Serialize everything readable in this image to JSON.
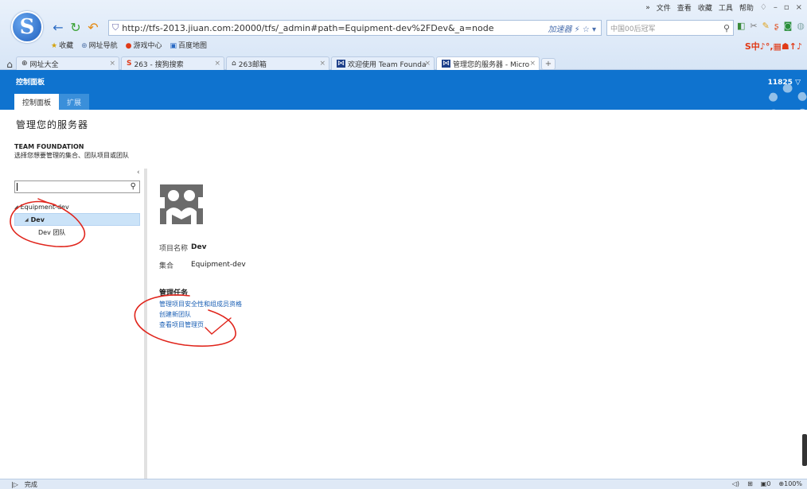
{
  "browser": {
    "logo_letter": "S",
    "top_menu": [
      "»",
      "文件",
      "查看",
      "收藏",
      "工具",
      "帮助"
    ],
    "address": "http://tfs-2013.jiuan.com:20000/tfs/_admin#path=Equipment-dev%2FDev&_a=node",
    "accelerator": "加速器",
    "search_placeholder": "中国00后冠军",
    "favorites": [
      {
        "icon": "★",
        "label": "收藏"
      },
      {
        "icon": "⊕",
        "label": "网址导航"
      },
      {
        "icon": "●",
        "label": "游戏中心"
      },
      {
        "icon": "▣",
        "label": "百度地图"
      }
    ],
    "sogou_toolbar": "S中♪°,▦☗↑♪",
    "tabs": [
      {
        "icon": "⊕",
        "label": "网址大全",
        "active": false
      },
      {
        "icon": "S",
        "label": "263 - 搜狗搜索",
        "active": false
      },
      {
        "icon": "⌂",
        "label": "263邮箱",
        "active": false
      },
      {
        "icon": "⋈",
        "label": "欢迎使用 Team Founda",
        "active": false
      },
      {
        "icon": "⋈",
        "label": "管理您的服务器 - Micro",
        "active": true
      }
    ],
    "new_tab": "+",
    "status": "完成",
    "status_right": [
      "◁)",
      "⊞",
      "▣0",
      "⊕100%"
    ]
  },
  "tfs": {
    "header_title": "控制面板",
    "tabs": [
      "控制面板",
      "扩展"
    ],
    "user": "11825 ▽"
  },
  "page": {
    "title": "管理您的服务器",
    "section_head": "TEAM FOUNDATION",
    "section_sub": "选择您想要管理的集合、团队项目或团队",
    "collapse": "‹",
    "tree": [
      {
        "label": "Equipment-dev",
        "level": "root"
      },
      {
        "label": "Dev",
        "level": "lvl1"
      },
      {
        "label": "Dev 团队",
        "level": "lvl2"
      }
    ],
    "meta": {
      "name_label": "项目名称",
      "name_value": "Dev",
      "collection_label": "集合",
      "collection_value": "Equipment-dev"
    },
    "tasks_head": "管理任务",
    "tasks": [
      "管理项目安全性和组成员资格",
      "创建新团队",
      "查看项目管理页"
    ]
  },
  "colors": {
    "tfs_blue": "#0f73cf",
    "link": "#1a5fb4",
    "annotation": "#e0241b",
    "tree_selected": "#cbe3f8"
  }
}
